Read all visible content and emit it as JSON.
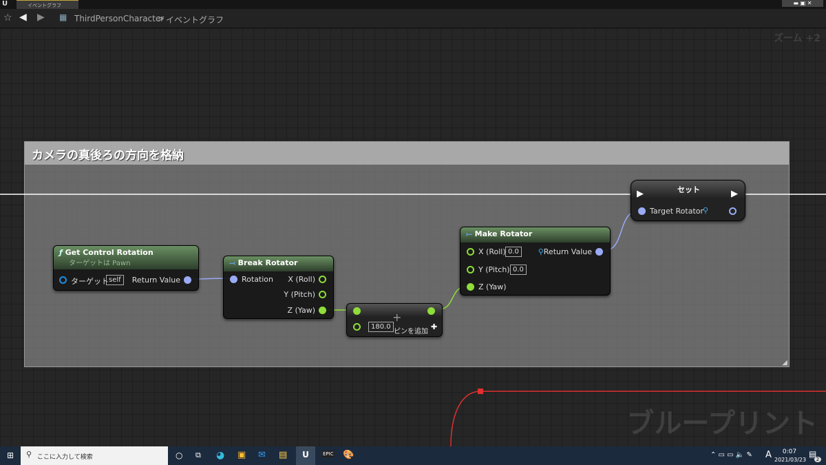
{
  "window": {
    "tab_title": "イベントグラフ",
    "breadcrumb_root": "ThirdPersonCharacter",
    "breadcrumb_separator": ">",
    "breadcrumb_current": "イベントグラフ"
  },
  "graph": {
    "zoom_label": "ズーム +2",
    "watermark": "ブループリント",
    "comment": {
      "title": "カメラの真後ろの方向を格納"
    },
    "nodes": {
      "get_control_rotation": {
        "title": "Get Control Rotation",
        "subtitle": "ターゲットは Pawn",
        "target_label": "ターゲット",
        "target_value": "self",
        "output": "Return Value"
      },
      "break_rotator": {
        "title": "Break Rotator",
        "input": "Rotation",
        "outputs": [
          "X (Roll)",
          "Y (Pitch)",
          "Z (Yaw)"
        ]
      },
      "add": {
        "value": "180.0",
        "add_pin_label": "ピンを追加"
      },
      "make_rotator": {
        "title": "Make Rotator",
        "inputs": [
          {
            "label": "X (Roll)",
            "value": "0.0"
          },
          {
            "label": "Y (Pitch)",
            "value": "0.0"
          },
          {
            "label": "Z (Yaw)"
          }
        ],
        "output": "Return Value"
      },
      "set": {
        "title": "セット",
        "input": "Target Rotator"
      }
    }
  },
  "taskbar": {
    "search_placeholder": "ここに入力して検索",
    "time": "0:07",
    "date": "2021/03/23",
    "ime": "A",
    "notifications": "2"
  },
  "colors": {
    "float_pin": "#8fdc3a",
    "rotator_pin": "#9aaaf5",
    "exec_wire": "#ffffff",
    "selected_wire": "#e03030"
  }
}
